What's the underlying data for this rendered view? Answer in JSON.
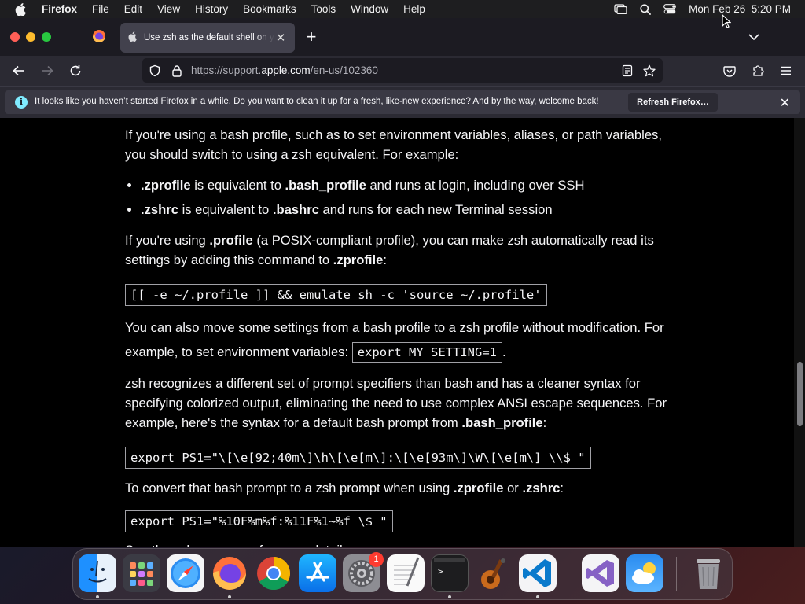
{
  "menubar": {
    "app_name": "Firefox",
    "items": [
      "File",
      "Edit",
      "View",
      "History",
      "Bookmarks",
      "Tools",
      "Window",
      "Help"
    ],
    "clock": "Mon Feb 26  5:20 PM"
  },
  "browser": {
    "tab_title": "Use zsh as the default shell on your Mac",
    "url_prefix": "https://support.",
    "url_domain": "apple.com",
    "url_path": "/en-us/102360",
    "notification": "It looks like you haven’t started Firefox in a while. Do you want to clean it up for a fresh, like-new experience? And by the way, welcome back!",
    "refresh_label": "Refresh Firefox…",
    "info_glyph": "i"
  },
  "article": {
    "p1": "If you're using a bash profile, such as to set environment variables, aliases, or path variables, you should switch to using a zsh equivalent. For example:",
    "li1_a": ".zprofile",
    "li1_b": " is equivalent to ",
    "li1_c": ".bash_profile",
    "li1_d": " and runs at login, including over SSH",
    "li2_a": ".zshrc",
    "li2_b": " is equivalent to ",
    "li2_c": ".bashrc",
    "li2_d": " and runs for each new Terminal session",
    "p2_a": "If you're using ",
    "p2_b": ".profile",
    "p2_c": " (a POSIX-compliant profile), you can make zsh automatically read its settings by adding this command to ",
    "p2_d": ".zprofile",
    "p2_e": ":",
    "code1": "[[ -e ~/.profile ]] && emulate sh -c 'source ~/.profile'",
    "p3_a": "You can also move some settings from a bash profile to a zsh profile without modification. For example, to set environment variables: ",
    "code_inline": "export MY_SETTING=1",
    "p3_b": ".",
    "p4_a": "zsh recognizes a different set of prompt specifiers than bash and has a cleaner syntax for specifying colorized output, eliminating the need to use complex ANSI escape sequences. For example, here's the syntax for a default bash prompt from ",
    "p4_b": ".bash_profile",
    "p4_c": ":",
    "code2": "export PS1=\"\\[\\e[92;40m\\]\\h\\[\\e[m\\]:\\[\\e[93m\\]\\W\\[\\e[m\\] \\\\$ \"",
    "p5_a": "To convert that bash prompt to a zsh prompt when using ",
    "p5_b": ".zprofile",
    "p5_c": " or ",
    "p5_d": ".zshrc",
    "p5_e": ":",
    "code3": "export PS1=\"%10F%m%f:%11F%1~%f \\$ \"",
    "p6_partial": "See the zsh man page for more details."
  },
  "dock": {
    "items": [
      "Finder",
      "Launchpad",
      "Safari",
      "Firefox",
      "Google Chrome",
      "App Store",
      "System Settings",
      "TextEdit",
      "Terminal",
      "Instruments",
      "Visual Studio Code",
      "Visual Studio",
      "Weather",
      "Trash"
    ],
    "system_settings_badge": "1"
  },
  "colors": {
    "accent_info": "#80ebff",
    "menubar_bg": "#1e1e20",
    "tab_bg": "#42414d",
    "page_bg": "#000000"
  }
}
